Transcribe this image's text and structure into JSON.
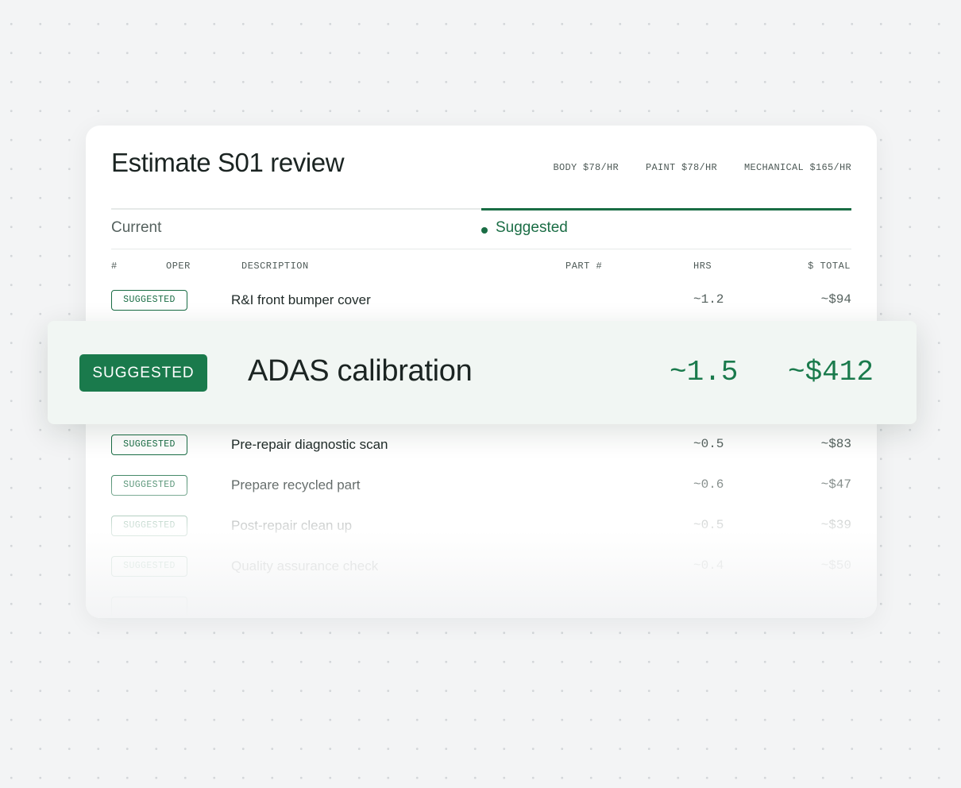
{
  "estimate": {
    "title": "Estimate S01 review",
    "rates": [
      "BODY $78/HR",
      "PAINT $78/HR",
      "MECHANICAL $165/HR"
    ]
  },
  "tabs": {
    "current": "Current",
    "suggested": "Suggested",
    "active": "Suggested"
  },
  "columns": {
    "num": "#",
    "oper": "OPER",
    "description": "DESCRIPTION",
    "part": "PART #",
    "hrs": "HRS",
    "total": "$ TOTAL"
  },
  "rows": [
    {
      "badge": "SUGGESTED",
      "description": "R&I front bumper cover",
      "hrs": "~1.2",
      "total": "~$94"
    },
    {
      "badge": "SUGGESTED",
      "description": "Pre-repair diagnostic scan",
      "hrs": "~0.5",
      "total": "~$83"
    },
    {
      "badge": "SUGGESTED",
      "description": "Prepare recycled part",
      "hrs": "~0.6",
      "total": "~$47"
    },
    {
      "badge": "SUGGESTED",
      "description": "Post-repair clean up",
      "hrs": "~0.5",
      "total": "~$39"
    },
    {
      "badge": "SUGGESTED",
      "description": "Quality assurance check",
      "hrs": "~0.4",
      "total": "~$50"
    }
  ],
  "highlight": {
    "badge": "SUGGESTED",
    "description": "ADAS calibration",
    "hrs": "~1.5",
    "total": "~$412"
  },
  "colors": {
    "accent": "#1a6d45",
    "badge_fill": "#1a7a4c",
    "highlight_bg": "#f1f6f3"
  }
}
